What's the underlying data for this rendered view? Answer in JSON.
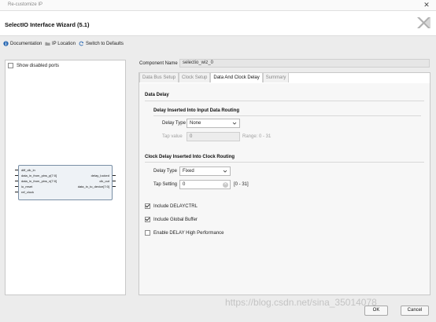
{
  "window": {
    "title": "Re-customize IP"
  },
  "header": {
    "wizard_title": "SelectIO Interface Wizard (5.1)",
    "logo_icon": "xilinx-logo-icon"
  },
  "toolbar": {
    "documentation": "Documentation",
    "ip_location": "IP Location",
    "switch_defaults": "Switch to Defaults"
  },
  "left_panel": {
    "show_disabled_ports": "Show disabled ports",
    "block": {
      "left_ports": [
        "diff_clk_in",
        "data_in_from_pins_p[7:0]",
        "data_in_from_pins_n[7:0]",
        "io_reset",
        "ref_clock"
      ],
      "right_ports": [
        "delay_locked",
        "clk_out",
        "data_in_to_device[7:0]"
      ]
    }
  },
  "component": {
    "label": "Component Name",
    "value": "selectio_wiz_0"
  },
  "tabs": [
    "Data Bus Setup",
    "Clock Setup",
    "Data And Clock Delay",
    "Summary"
  ],
  "content": {
    "data_delay": {
      "heading": "Data Delay",
      "subheading": "Delay Inserted Into Input Data Routing",
      "delay_type_label": "Delay Type",
      "delay_type_value": "None",
      "tap_value_label": "Tap value",
      "tap_value_value": "0",
      "tap_range": "Range: 0 - 31"
    },
    "clock_delay": {
      "heading": "Clock Delay Inserted Into Clock Routing",
      "delay_type_label": "Delay Type",
      "delay_type_value": "Fixed",
      "tap_setting_label": "Tap Setting",
      "tap_setting_value": "0",
      "tap_range": "[0 - 31]"
    },
    "options": {
      "include_delayctrl": "Include DELAYCTRL",
      "include_global_buffer": "Include Global Buffer",
      "enable_delay_high_perf": "Enable DELAY High Performance"
    }
  },
  "buttons": {
    "ok": "OK",
    "cancel": "Cancel"
  },
  "watermark": "https://blog.csdn.net/sina_35014078",
  "colors": {
    "accent": "#2f6db5",
    "panel_border": "#c8c8c8",
    "block_fill": "#eef2f6"
  }
}
